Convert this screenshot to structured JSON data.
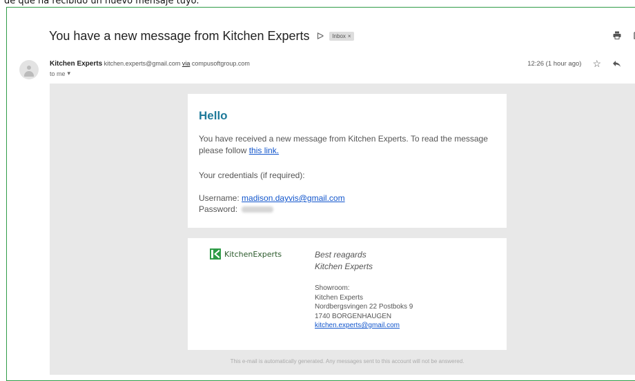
{
  "caption": "de que ha recibido un nuevo mensaje tuyo.",
  "email": {
    "subject": "You have a new message from Kitchen Experts",
    "label": "Inbox",
    "label_close": "×",
    "sender_name": "Kitchen Experts",
    "sender_email": "kitchen.experts@gmail.com",
    "via_word": "via",
    "via_domain": "compusoftgroup.com",
    "to": "to me",
    "time": "12:26 (1 hour ago)"
  },
  "message": {
    "greeting": "Hello",
    "intro": "You have received a new message from Kitchen Experts. To read the message please follow",
    "link_text": "this link.",
    "credentials_label": "Your credentials (if required):",
    "username_label": "Username:",
    "username_value": "madison.dayvis@gmail.com",
    "password_label": "Password:"
  },
  "signature": {
    "logo_text": "KitchenExperts",
    "closing": "Best reagards",
    "company": "Kitchen Experts",
    "showroom_label": "Showroom:",
    "address_company": "Kitchen Experts",
    "street": "Nordbergsvingen 22 Postboks 9",
    "city": "1740 BORGENHAUGEN",
    "email": "kitchen.experts@gmail.com"
  },
  "footer": "This e-mail is automatically generated. Any messages sent to this account will not be answered.",
  "icons": {
    "important": "importance-marker-icon",
    "print": "print-icon",
    "open_new": "open-in-new-window-icon",
    "star": "star-icon",
    "reply": "reply-icon",
    "more": "more-vertical-icon"
  },
  "colors": {
    "frame_border": "#2e9b46",
    "greeting": "#1f7a9a",
    "link": "#1155cc",
    "body_bg": "#e8e8e8"
  }
}
